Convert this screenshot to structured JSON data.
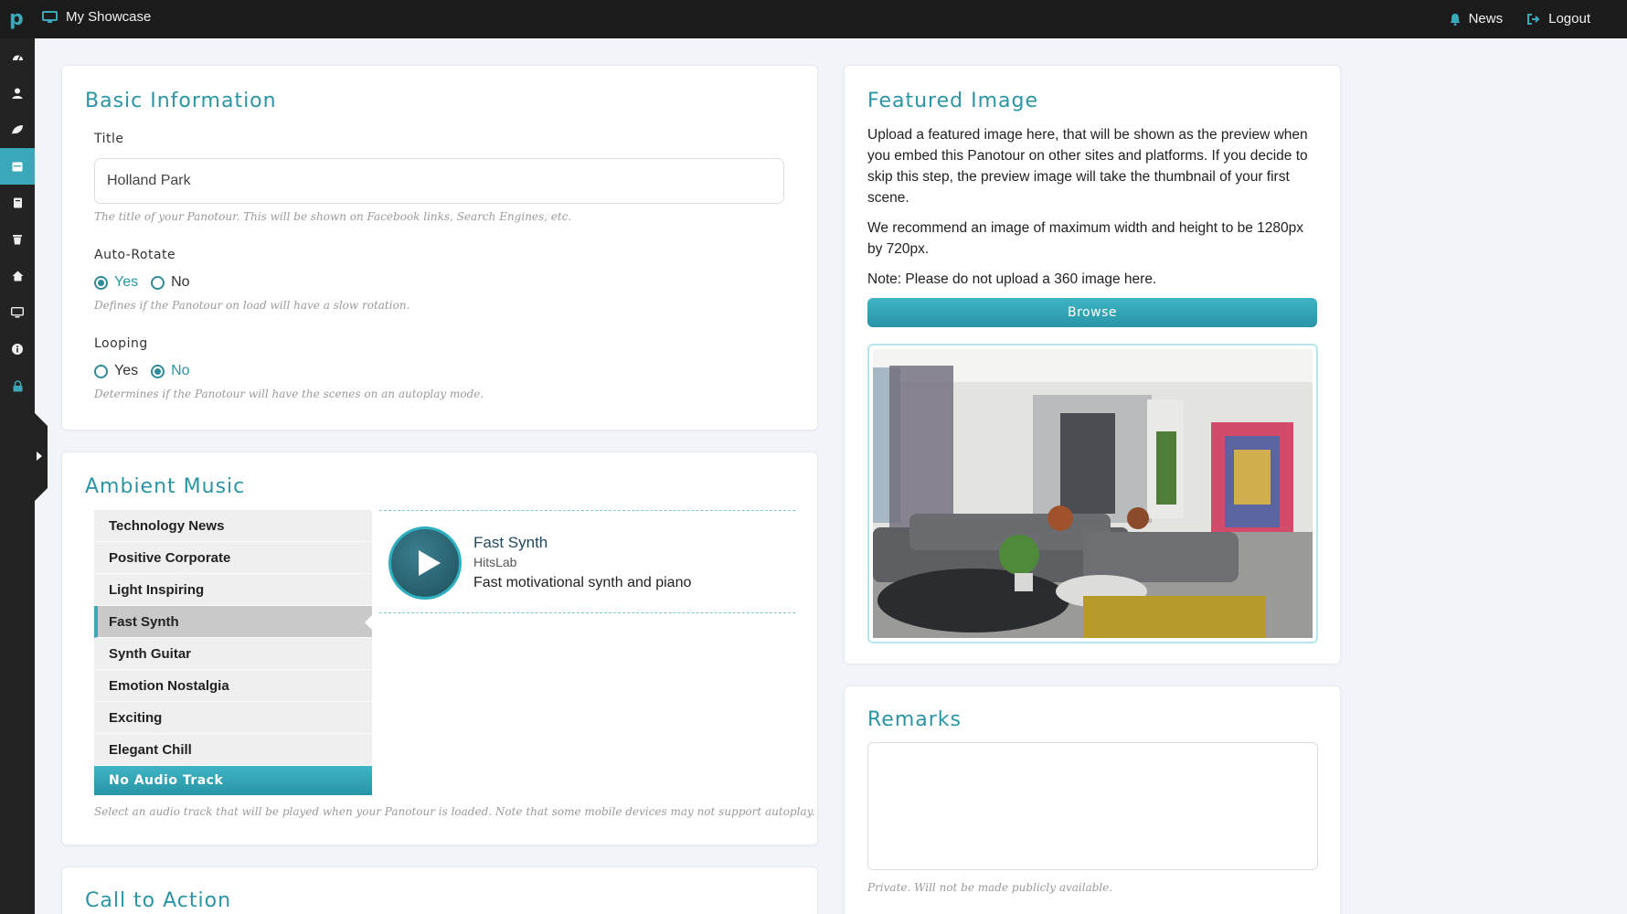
{
  "app": {
    "logo": "p",
    "title": "My Showcase"
  },
  "topnav": {
    "news": "News",
    "logout": "Logout"
  },
  "sidebar": {
    "items": [
      {
        "icon": "dashboard-icon"
      },
      {
        "icon": "user-icon"
      },
      {
        "icon": "leaf-icon"
      },
      {
        "icon": "calendar-icon",
        "active": true
      },
      {
        "icon": "book-icon"
      },
      {
        "icon": "trash-icon"
      },
      {
        "icon": "home-icon"
      },
      {
        "icon": "desktop-icon"
      },
      {
        "icon": "info-icon"
      },
      {
        "icon": "lock-icon"
      }
    ]
  },
  "basic": {
    "heading": "Basic Information",
    "title_label": "Title",
    "title_value": "Holland Park",
    "title_help": "The title of your Panotour. This will be shown on Facebook links, Search Engines, etc.",
    "autorotate_label": "Auto-Rotate",
    "autorotate_yes": "Yes",
    "autorotate_no": "No",
    "autorotate_help": "Defines if the Panotour on load will have a slow rotation.",
    "looping_label": "Looping",
    "looping_yes": "Yes",
    "looping_no": "No",
    "looping_help": "Determines if the Panotour will have the scenes on an autoplay mode."
  },
  "music": {
    "heading": "Ambient Music",
    "tracks": [
      "Technology News",
      "Positive Corporate",
      "Light Inspiring",
      "Fast Synth",
      "Synth Guitar",
      "Emotion Nostalgia",
      "Exciting",
      "Elegant Chill"
    ],
    "no_audio": "No Audio Track",
    "player": {
      "title": "Fast Synth",
      "artist": "HitsLab",
      "description": "Fast motivational synth and piano"
    },
    "help": "Select an audio track that will be played when your Panotour is loaded. Note that some mobile devices may not support autoplay."
  },
  "cta": {
    "heading": "Call to Action"
  },
  "featured": {
    "heading": "Featured Image",
    "p1": "Upload a featured image here, that will be shown as the preview when you embed this Panotour on other sites and platforms. If you decide to skip this step, the preview image will take the thumbnail of your first scene.",
    "p2": "We recommend an image of maximum width and height to be 1280px by 720px.",
    "p3": "Note: Please do not upload a 360 image here.",
    "browse": "Browse"
  },
  "remarks": {
    "heading": "Remarks",
    "help": "Private. Will not be made publicly available."
  },
  "colors": {
    "accent": "#2b95a5",
    "topbar": "#1b1b1b",
    "sidebar": "#232323",
    "page_bg": "#f1f4f9"
  }
}
